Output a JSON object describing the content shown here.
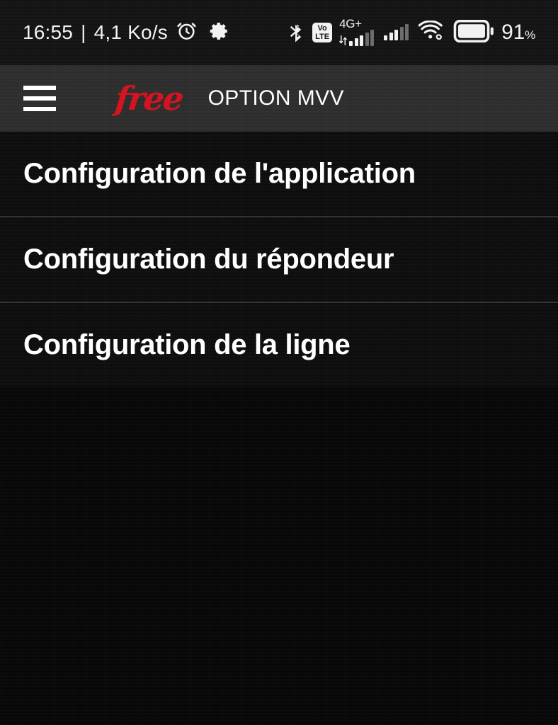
{
  "status_bar": {
    "time": "16:55",
    "separator": "|",
    "network_speed": "4,1 Ko/s",
    "alarm_icon": "alarm-clock-icon",
    "settings_icon": "gear-icon",
    "bluetooth_icon": "bluetooth-icon",
    "volte_line1": "Vo",
    "volte_line2": "LTE",
    "network_type": "4G+",
    "wifi_icon": "wifi-icon",
    "battery_icon": "battery-icon",
    "battery_level": "91",
    "battery_unit": "%"
  },
  "header": {
    "menu_icon": "hamburger-menu-icon",
    "brand": "free",
    "title": "OPTION MVV",
    "background_color": "#2b2b2b",
    "brand_color": "#d2101c"
  },
  "menu": {
    "items": [
      {
        "label": "Configuration de l'application"
      },
      {
        "label": "Configuration du répondeur"
      },
      {
        "label": "Configuration de la ligne"
      }
    ]
  },
  "colors": {
    "screen_background": "#080808",
    "list_background": "#0b0b0b",
    "divider": "#2e2e2e",
    "text_primary": "#ffffff",
    "status_bar_background": "#111111"
  }
}
